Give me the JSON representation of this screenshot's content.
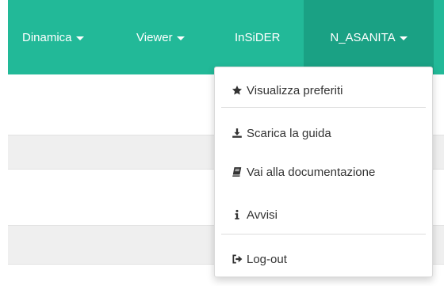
{
  "navbar": {
    "bg_color": "#22b998",
    "active_bg_color": "#1aa184",
    "items": [
      {
        "label": "Dinamica",
        "has_caret": true
      },
      {
        "label": "Viewer",
        "has_caret": true
      },
      {
        "label": "InSiDER",
        "has_caret": false
      },
      {
        "label": "N_ASANITA",
        "has_caret": true,
        "active": true
      }
    ]
  },
  "user_menu": {
    "items": [
      {
        "label": "Visualizza preferiti",
        "icon": "star-icon"
      },
      {
        "label": "Scarica la guida",
        "icon": "download-icon"
      },
      {
        "label": "Vai alla documentazione",
        "icon": "book-icon"
      },
      {
        "label": "Avvisi",
        "icon": "info-icon"
      },
      {
        "label": "Log-out",
        "icon": "sign-out-icon"
      }
    ]
  }
}
